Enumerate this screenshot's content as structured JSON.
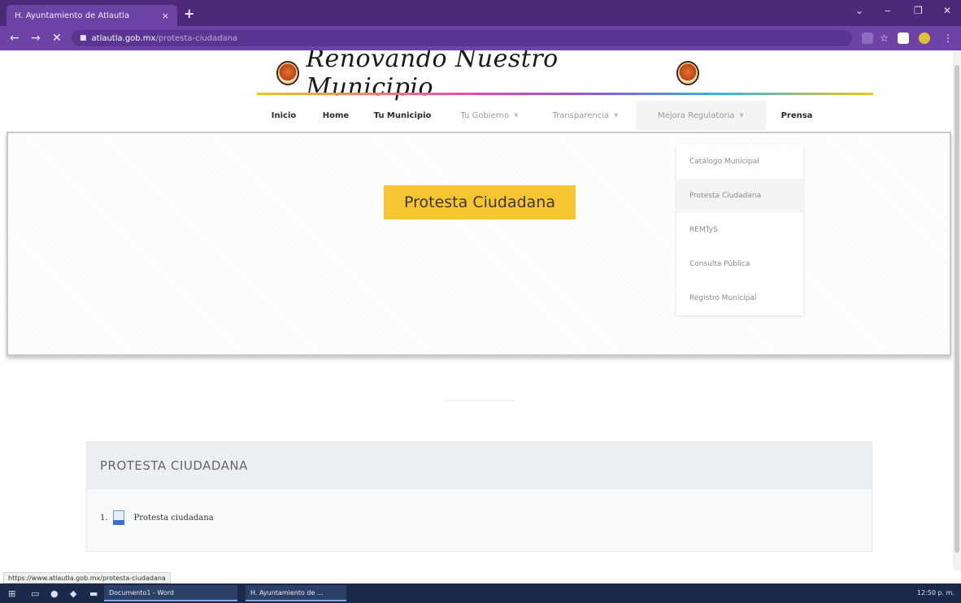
{
  "browser": {
    "tab_title": "H. Ayuntamiento de Atlautla",
    "tab_close": "×",
    "new_tab": "+",
    "url_domain": "atlautla.gob.mx",
    "url_path": "/protesta-ciudadana",
    "window_controls": {
      "minimize": "‒",
      "restore": "❐",
      "close": "✕",
      "menu": "⌄"
    },
    "nav": {
      "back": "←",
      "forward": "→",
      "stop": "✕"
    },
    "toolbar_icons": {
      "star": "☆",
      "menu": "⋮"
    },
    "status_url": "https://www.atlautla.gob.mx/protesta-ciudadana"
  },
  "site": {
    "logo_text": "Renovando Nuestro Municipio",
    "nav": [
      {
        "label": "Inicio",
        "dropdown": false,
        "dim": false
      },
      {
        "label": "Home",
        "dropdown": false,
        "dim": false
      },
      {
        "label": "Tu Municipio",
        "dropdown": false,
        "dim": false
      },
      {
        "label": "Tu Gobierno",
        "dropdown": true,
        "dim": true
      },
      {
        "label": "Transparencia",
        "dropdown": true,
        "dim": true
      },
      {
        "label": "Mejora Regulatoria",
        "dropdown": true,
        "dim": true
      },
      {
        "label": "Prensa",
        "dropdown": false,
        "dim": false
      }
    ],
    "hero_title": "Protesta Ciudadana",
    "dropdown_items": [
      {
        "label": "Catálogo Municipal"
      },
      {
        "label": "Protesta Ciudadana"
      },
      {
        "label": "REMTyS"
      },
      {
        "label": "Consulta Pública"
      },
      {
        "label": "Registro Municipal"
      }
    ],
    "panel": {
      "heading": "PROTESTA CIUDADANA",
      "items": [
        {
          "number": "1.",
          "label": "Protesta ciudadana"
        }
      ]
    }
  },
  "taskbar": {
    "apps": [
      {
        "label": "Documento1 - Word"
      },
      {
        "label": "H. Ayuntamiento de ..."
      }
    ],
    "tray_time": "12:50 p. m."
  },
  "colors": {
    "browser_frame": "#6d44a6",
    "hero_badge": "#f7c531",
    "taskbar": "#1b2a4c"
  }
}
